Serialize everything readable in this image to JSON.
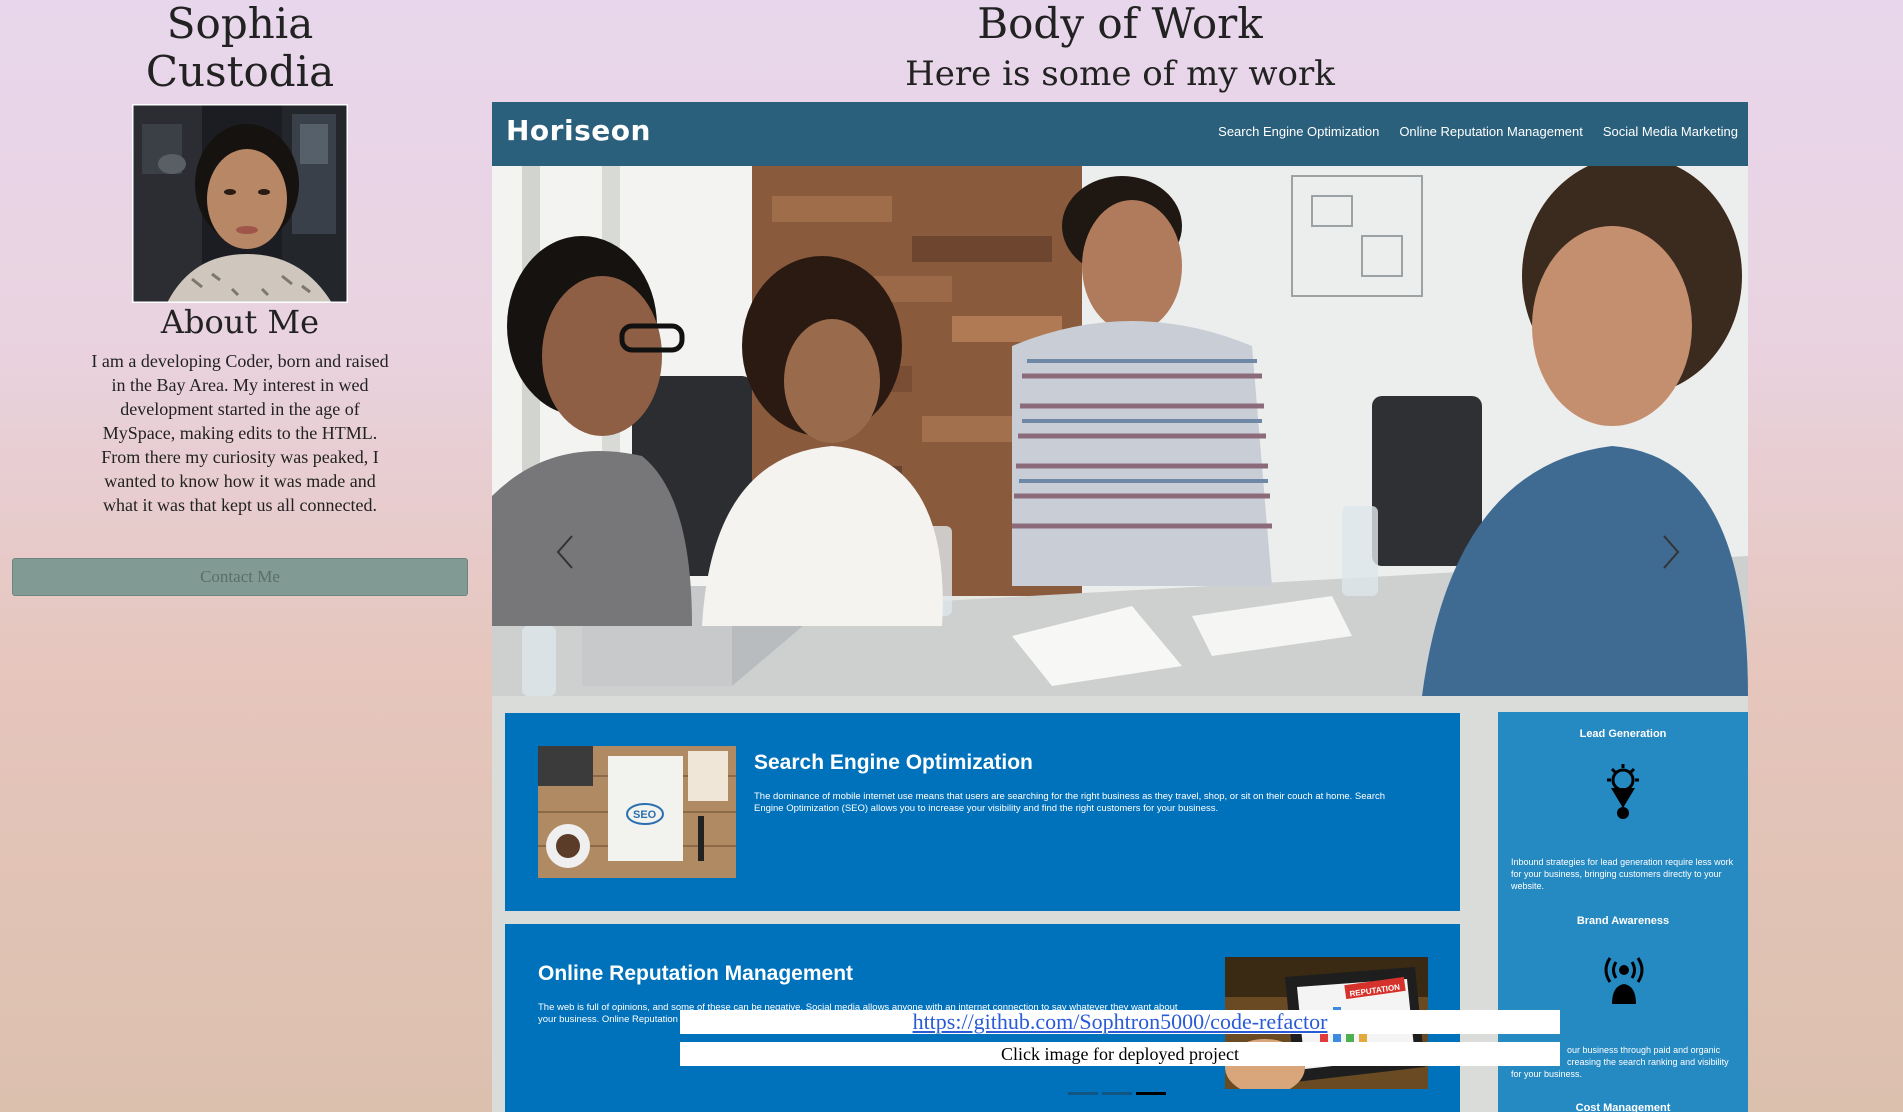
{
  "profile": {
    "name_line1": "Sophia",
    "name_line2": "Custodia",
    "about_title": "About Me",
    "about_text": "I am a developing Coder, born and raised in the Bay Area. My interest in wed development started in the age of MySpace, making edits to the HTML. From there my curiosity was peaked, I wanted to know how it was made and what it was that kept us all connected.",
    "contact_label": "Contact Me"
  },
  "work": {
    "title": "Body of Work",
    "subtitle": "Here is some of my work",
    "slide": {
      "logo": "Horiseon",
      "nav": [
        "Search Engine Optimization",
        "Online Reputation Management",
        "Social Media Marketing"
      ],
      "seo_title": "Search Engine Optimization",
      "seo_text": "The dominance of mobile internet use means that users are searching for the right business as they travel, shop, or sit on their couch at home. Search Engine Optimization (SEO) allows you to increase your visibility and find the right customers for your business.",
      "orm_title": "Online Reputation Management",
      "orm_text_1": "The web is full of opinions, and some of these can be negative. Social media allows anyone with an internet connection to say whatever they want about",
      "orm_text_2": "your business. Online Reputation",
      "side_lead_title": "Lead Generation",
      "side_lead_text": "Inbound strategies for lead generation require less work for your business, bringing customers directly to your website.",
      "side_brand_title": "Brand Awareness",
      "side_brand_text_1": "our business through paid and organic",
      "side_brand_text_2": "creasing the search ranking and visibility",
      "side_brand_text_3": "for your business.",
      "side_cost_title": "Cost Management",
      "seo_badge": "SEO",
      "reputation_badge": "REPUTATION"
    },
    "link": "https://github.com/Sophtron5000/code-refactor",
    "caption": "Click image for deployed project",
    "indicator_count": 3,
    "active_indicator": 3
  },
  "colors": {
    "header_bar": "#2a607c",
    "card_blue": "#0072bb",
    "side_panel": "#2589c2",
    "contact_button": "#829a94",
    "link": "#2a5bd7"
  }
}
